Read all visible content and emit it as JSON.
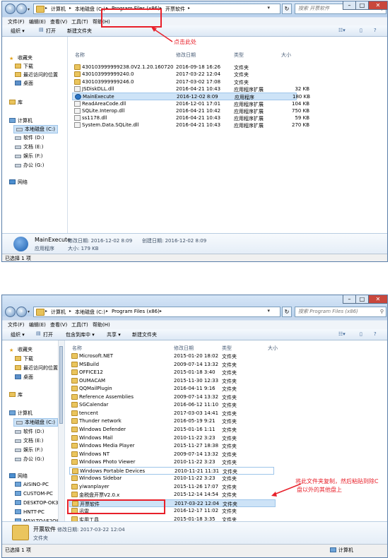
{
  "top": {
    "breadcrumbs": [
      "计算机",
      "本地磁盘 (C:)",
      "Program Files (x86)",
      "开票软件"
    ],
    "search_placeholder": "搜索 开票软件",
    "menu": [
      "文件(F)",
      "编辑(E)",
      "查看(V)",
      "工具(T)",
      "帮助(H)"
    ],
    "toolbar": [
      "组织 ▾",
      "打开",
      "新建文件夹"
    ],
    "nav": {
      "favorites": "收藏夹",
      "downloads": "下载",
      "recent": "最近访问的位置",
      "desktop": "桌面",
      "libraries": "库",
      "computer": "计算机",
      "drives": [
        "本地磁盘 (C:)",
        "软件 (D:)",
        "文档 (E:)",
        "娱乐 (F:)",
        "办公 (G:)"
      ],
      "network": "网络"
    },
    "columns": [
      "名称",
      "修改日期",
      "类型",
      "大小"
    ],
    "files": [
      {
        "name": "430103999999238.0V2.1.20.160720",
        "date": "2016-09-18 16:26",
        "type": "文件夹",
        "size": "",
        "icon": "folder"
      },
      {
        "name": "430103999999240.0",
        "date": "2017-03-22 12:04",
        "type": "文件夹",
        "size": "",
        "icon": "folder"
      },
      {
        "name": "430103999999246.0",
        "date": "2017-03-02 17:08",
        "type": "文件夹",
        "size": "",
        "icon": "folder"
      },
      {
        "name": "JSDiskDLL.dll",
        "date": "2016-04-21 10:43",
        "type": "应用程序扩展",
        "size": "32 KB",
        "icon": "dll"
      },
      {
        "name": "MainExecute",
        "date": "2016-12-02 8:09",
        "type": "应用程序",
        "size": "180 KB",
        "icon": "exe"
      },
      {
        "name": "ReadAreaCode.dll",
        "date": "2016-12-01 17:01",
        "type": "应用程序扩展",
        "size": "104 KB",
        "icon": "dll"
      },
      {
        "name": "SQLite.Interop.dll",
        "date": "2016-04-21 10:42",
        "type": "应用程序扩展",
        "size": "750 KB",
        "icon": "dll"
      },
      {
        "name": "ss1178.dll",
        "date": "2016-04-21 10:43",
        "type": "应用程序扩展",
        "size": "59 KB",
        "icon": "dll"
      },
      {
        "name": "System.Data.SQLite.dll",
        "date": "2016-04-21 10:43",
        "type": "应用程序扩展",
        "size": "270 KB",
        "icon": "dll"
      }
    ],
    "details": {
      "name": "MainExecute",
      "modified": "修改日期: 2016-12-02 8:09",
      "created": "创建日期: 2016-12-02 8:09",
      "kind": "应用程序",
      "size": "大小: 179 KB"
    },
    "status": "已选择 1 项",
    "annotation": "点击此处"
  },
  "bottom": {
    "breadcrumbs": [
      "计算机",
      "本地磁盘 (C:)",
      "Program Files (x86)"
    ],
    "search_placeholder": "搜索 Program Files (x86)",
    "menu": [
      "文件(F)",
      "编辑(E)",
      "查看(V)",
      "工具(T)",
      "帮助(H)"
    ],
    "toolbar": [
      "组织 ▾",
      "打开",
      "包含到库中 ▾",
      "共享 ▾",
      "新建文件夹"
    ],
    "nav": {
      "favorites": "收藏夹",
      "downloads": "下载",
      "recent": "最近访问的位置",
      "desktop": "桌面",
      "libraries": "库",
      "computer": "计算机",
      "drives": [
        "本地磁盘 (C:)",
        "软件 (D:)",
        "文档 (E:)",
        "娱乐 (F:)",
        "办公 (G:)"
      ],
      "network": "网络",
      "network_items": [
        "AISINO-PC",
        "CUSTOM-PC",
        "DESKTOP-OK3F",
        "HNTT-PC",
        "M5YLTQAE2O8"
      ]
    },
    "columns": [
      "名称",
      "修改日期",
      "类型",
      "大小"
    ],
    "files": [
      {
        "name": "Microsoft.NET",
        "date": "2015-01-20 18:02",
        "type": "文件夹"
      },
      {
        "name": "MSBuild",
        "date": "2009-07-14 13:32",
        "type": "文件夹"
      },
      {
        "name": "OFFICE12",
        "date": "2015-01-18 3:40",
        "type": "文件夹"
      },
      {
        "name": "OUMACAM",
        "date": "2015-11-30 12:33",
        "type": "文件夹"
      },
      {
        "name": "QQMailPlugin",
        "date": "2016-04-11 9:16",
        "type": "文件夹"
      },
      {
        "name": "Reference Assemblies",
        "date": "2009-07-14 13:32",
        "type": "文件夹"
      },
      {
        "name": "SGCalendar",
        "date": "2016-06-12 11:10",
        "type": "文件夹"
      },
      {
        "name": "tencent",
        "date": "2017-03-03 14:41",
        "type": "文件夹"
      },
      {
        "name": "Thunder network",
        "date": "2016-05-19 9:21",
        "type": "文件夹"
      },
      {
        "name": "Windows Defender",
        "date": "2015-01-16 1:11",
        "type": "文件夹"
      },
      {
        "name": "Windows Mail",
        "date": "2010-11-22 3:23",
        "type": "文件夹"
      },
      {
        "name": "Windows Media Player",
        "date": "2015-11-27 18:38",
        "type": "文件夹"
      },
      {
        "name": "Windows NT",
        "date": "2009-07-14 13:32",
        "type": "文件夹"
      },
      {
        "name": "Windows Photo Viewer",
        "date": "2010-11-22 3:23",
        "type": "文件夹"
      },
      {
        "name": "Windows Portable Devices",
        "date": "2010-11-21 11:31",
        "type": "文件夹"
      },
      {
        "name": "Windows Sidebar",
        "date": "2010-11-22 3:23",
        "type": "文件夹"
      },
      {
        "name": "yiwanplayer",
        "date": "2015-11-26 17:07",
        "type": "文件夹"
      },
      {
        "name": "金税盘开票V2.0.x",
        "date": "2015-12-14 14:54",
        "type": "文件夹"
      },
      {
        "name": "开票软件",
        "date": "2017-03-22 12:04",
        "type": "文件夹"
      },
      {
        "name": "迅雷",
        "date": "2016-12-17 11:02",
        "type": "文件夹"
      },
      {
        "name": "实用工具",
        "date": "2015-01-18 3:35",
        "type": "文件夹"
      }
    ],
    "details": {
      "name": "开票软件",
      "modified": "修改日期: 2017-03-22 12:04",
      "kind": "文件夹"
    },
    "status": "已选择 1 项",
    "status_right": "计算机",
    "annotation_line1": "将此文件夹复制，然后粘贴到除C",
    "annotation_line2": "盘以外的其他盘上"
  },
  "colors": {
    "annotation": "#e8202a",
    "selection": "#cde3f7",
    "frame": "#c7d8ed"
  }
}
